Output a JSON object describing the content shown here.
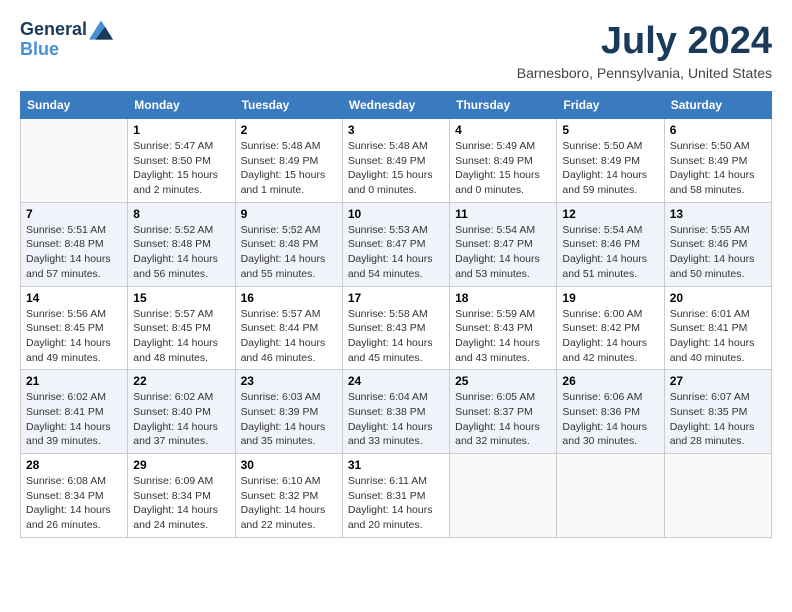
{
  "header": {
    "logo_general": "General",
    "logo_blue": "Blue",
    "title": "July 2024",
    "location": "Barnesboro, Pennsylvania, United States"
  },
  "days_of_week": [
    "Sunday",
    "Monday",
    "Tuesday",
    "Wednesday",
    "Thursday",
    "Friday",
    "Saturday"
  ],
  "weeks": [
    [
      {
        "day": "",
        "info": ""
      },
      {
        "day": "1",
        "info": "Sunrise: 5:47 AM\nSunset: 8:50 PM\nDaylight: 15 hours\nand 2 minutes."
      },
      {
        "day": "2",
        "info": "Sunrise: 5:48 AM\nSunset: 8:49 PM\nDaylight: 15 hours\nand 1 minute."
      },
      {
        "day": "3",
        "info": "Sunrise: 5:48 AM\nSunset: 8:49 PM\nDaylight: 15 hours\nand 0 minutes."
      },
      {
        "day": "4",
        "info": "Sunrise: 5:49 AM\nSunset: 8:49 PM\nDaylight: 15 hours\nand 0 minutes."
      },
      {
        "day": "5",
        "info": "Sunrise: 5:50 AM\nSunset: 8:49 PM\nDaylight: 14 hours\nand 59 minutes."
      },
      {
        "day": "6",
        "info": "Sunrise: 5:50 AM\nSunset: 8:49 PM\nDaylight: 14 hours\nand 58 minutes."
      }
    ],
    [
      {
        "day": "7",
        "info": "Sunrise: 5:51 AM\nSunset: 8:48 PM\nDaylight: 14 hours\nand 57 minutes."
      },
      {
        "day": "8",
        "info": "Sunrise: 5:52 AM\nSunset: 8:48 PM\nDaylight: 14 hours\nand 56 minutes."
      },
      {
        "day": "9",
        "info": "Sunrise: 5:52 AM\nSunset: 8:48 PM\nDaylight: 14 hours\nand 55 minutes."
      },
      {
        "day": "10",
        "info": "Sunrise: 5:53 AM\nSunset: 8:47 PM\nDaylight: 14 hours\nand 54 minutes."
      },
      {
        "day": "11",
        "info": "Sunrise: 5:54 AM\nSunset: 8:47 PM\nDaylight: 14 hours\nand 53 minutes."
      },
      {
        "day": "12",
        "info": "Sunrise: 5:54 AM\nSunset: 8:46 PM\nDaylight: 14 hours\nand 51 minutes."
      },
      {
        "day": "13",
        "info": "Sunrise: 5:55 AM\nSunset: 8:46 PM\nDaylight: 14 hours\nand 50 minutes."
      }
    ],
    [
      {
        "day": "14",
        "info": "Sunrise: 5:56 AM\nSunset: 8:45 PM\nDaylight: 14 hours\nand 49 minutes."
      },
      {
        "day": "15",
        "info": "Sunrise: 5:57 AM\nSunset: 8:45 PM\nDaylight: 14 hours\nand 48 minutes."
      },
      {
        "day": "16",
        "info": "Sunrise: 5:57 AM\nSunset: 8:44 PM\nDaylight: 14 hours\nand 46 minutes."
      },
      {
        "day": "17",
        "info": "Sunrise: 5:58 AM\nSunset: 8:43 PM\nDaylight: 14 hours\nand 45 minutes."
      },
      {
        "day": "18",
        "info": "Sunrise: 5:59 AM\nSunset: 8:43 PM\nDaylight: 14 hours\nand 43 minutes."
      },
      {
        "day": "19",
        "info": "Sunrise: 6:00 AM\nSunset: 8:42 PM\nDaylight: 14 hours\nand 42 minutes."
      },
      {
        "day": "20",
        "info": "Sunrise: 6:01 AM\nSunset: 8:41 PM\nDaylight: 14 hours\nand 40 minutes."
      }
    ],
    [
      {
        "day": "21",
        "info": "Sunrise: 6:02 AM\nSunset: 8:41 PM\nDaylight: 14 hours\nand 39 minutes."
      },
      {
        "day": "22",
        "info": "Sunrise: 6:02 AM\nSunset: 8:40 PM\nDaylight: 14 hours\nand 37 minutes."
      },
      {
        "day": "23",
        "info": "Sunrise: 6:03 AM\nSunset: 8:39 PM\nDaylight: 14 hours\nand 35 minutes."
      },
      {
        "day": "24",
        "info": "Sunrise: 6:04 AM\nSunset: 8:38 PM\nDaylight: 14 hours\nand 33 minutes."
      },
      {
        "day": "25",
        "info": "Sunrise: 6:05 AM\nSunset: 8:37 PM\nDaylight: 14 hours\nand 32 minutes."
      },
      {
        "day": "26",
        "info": "Sunrise: 6:06 AM\nSunset: 8:36 PM\nDaylight: 14 hours\nand 30 minutes."
      },
      {
        "day": "27",
        "info": "Sunrise: 6:07 AM\nSunset: 8:35 PM\nDaylight: 14 hours\nand 28 minutes."
      }
    ],
    [
      {
        "day": "28",
        "info": "Sunrise: 6:08 AM\nSunset: 8:34 PM\nDaylight: 14 hours\nand 26 minutes."
      },
      {
        "day": "29",
        "info": "Sunrise: 6:09 AM\nSunset: 8:34 PM\nDaylight: 14 hours\nand 24 minutes."
      },
      {
        "day": "30",
        "info": "Sunrise: 6:10 AM\nSunset: 8:32 PM\nDaylight: 14 hours\nand 22 minutes."
      },
      {
        "day": "31",
        "info": "Sunrise: 6:11 AM\nSunset: 8:31 PM\nDaylight: 14 hours\nand 20 minutes."
      },
      {
        "day": "",
        "info": ""
      },
      {
        "day": "",
        "info": ""
      },
      {
        "day": "",
        "info": ""
      }
    ]
  ]
}
